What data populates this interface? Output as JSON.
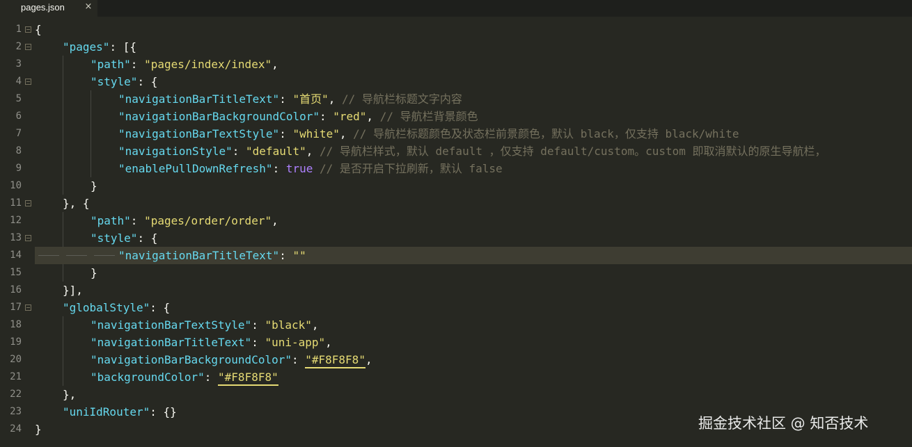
{
  "tab": {
    "label": "pages.json",
    "close": "×"
  },
  "watermark": "掘金技术社区 @ 知否技术",
  "colors": {
    "background": "#272822",
    "key": "#66d9ef",
    "string": "#e6db74",
    "comment": "#75715e",
    "boolean": "#ae81ff",
    "current_line": "#3e3d32"
  },
  "lines": [
    {
      "n": "1",
      "t": "{"
    },
    {
      "n": "2",
      "k": "\"pages\"",
      "p": ": [{"
    },
    {
      "n": "3",
      "k": "\"path\"",
      "p": ": ",
      "s": "\"pages/index/index\"",
      "p2": ","
    },
    {
      "n": "4",
      "k": "\"style\"",
      "p": ": {"
    },
    {
      "n": "5",
      "k": "\"navigationBarTitleText\"",
      "p": ": ",
      "s": "\"首页\"",
      "p2": ", ",
      "c": "// 导航栏标题文字内容"
    },
    {
      "n": "6",
      "k": "\"navigationBarBackgroundColor\"",
      "p": ": ",
      "s": "\"red\"",
      "p2": ", ",
      "c": "// 导航栏背景颜色"
    },
    {
      "n": "7",
      "k": "\"navigationBarTextStyle\"",
      "p": ": ",
      "s": "\"white\"",
      "p2": ", ",
      "c": "// 导航栏标题颜色及状态栏前景颜色，默认 black，仅支持 black/white"
    },
    {
      "n": "8",
      "k": "\"navigationStyle\"",
      "p": ": ",
      "s": "\"default\"",
      "p2": ", ",
      "c": "// 导航栏样式，默认 default ，仅支持 default/custom。custom 即取消默认的原生导航栏，"
    },
    {
      "n": "9",
      "k": "\"enablePullDownRefresh\"",
      "p": ": ",
      "b": "true",
      "c": " // 是否开启下拉刷新，默认 false"
    },
    {
      "n": "10",
      "t": "}"
    },
    {
      "n": "11",
      "t": "}, {"
    },
    {
      "n": "12",
      "k": "\"path\"",
      "p": ": ",
      "s": "\"pages/order/order\"",
      "p2": ","
    },
    {
      "n": "13",
      "k": "\"style\"",
      "p": ": {"
    },
    {
      "n": "14",
      "k": "\"navigationBarTitleText\"",
      "p": ": ",
      "s": "\"\""
    },
    {
      "n": "15",
      "t": "}"
    },
    {
      "n": "16",
      "t": "}],"
    },
    {
      "n": "17",
      "k": "\"globalStyle\"",
      "p": ": {"
    },
    {
      "n": "18",
      "k": "\"navigationBarTextStyle\"",
      "p": ": ",
      "s": "\"black\"",
      "p2": ","
    },
    {
      "n": "19",
      "k": "\"navigationBarTitleText\"",
      "p": ": ",
      "s": "\"uni-app\"",
      "p2": ","
    },
    {
      "n": "20",
      "k": "\"navigationBarBackgroundColor\"",
      "p": ": ",
      "s": "\"#F8F8F8\"",
      "p2": ","
    },
    {
      "n": "21",
      "k": "\"backgroundColor\"",
      "p": ": ",
      "s": "\"#F8F8F8\""
    },
    {
      "n": "22",
      "t": "},"
    },
    {
      "n": "23",
      "k": "\"uniIdRouter\"",
      "p": ": {}"
    },
    {
      "n": "24",
      "t": "}"
    }
  ]
}
